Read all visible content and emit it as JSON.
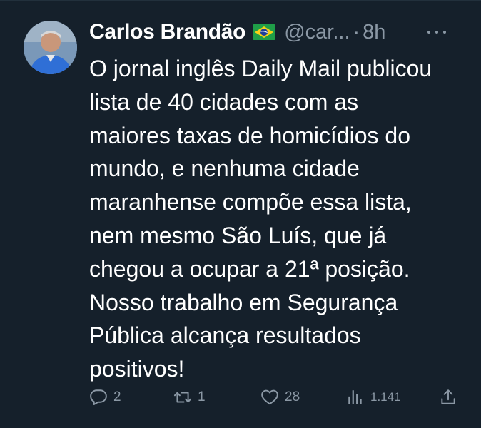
{
  "tweet": {
    "author_name": "Carlos Brandão",
    "handle": "@car...",
    "separator": "·",
    "time": "8h",
    "text": "O jornal inglês Daily Mail publicou\nlista de 40 cidades com as\nmaiores taxas de homicídios do\nmundo, e nenhuma cidade\nmaranhense compõe essa lista,\nnem mesmo São Luís, que já\nchegou a ocupar a 21ª posição.\nNosso trabalho em Segurança\nPública alcança resultados\npositivos!",
    "flag_icon": "brazil-flag-icon",
    "stats": {
      "replies": "2",
      "retweets": "1",
      "likes": "28",
      "views": "1.141"
    }
  },
  "colors": {
    "background": "#15202b",
    "muted": "#8b98a5",
    "text": "#ffffff"
  }
}
